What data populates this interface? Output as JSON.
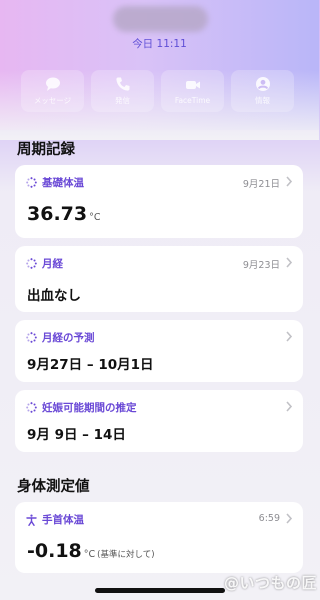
{
  "header": {
    "time": "今日 11:11",
    "actions": [
      {
        "label": "メッセージ",
        "icon": "message-icon"
      },
      {
        "label": "発信",
        "icon": "phone-icon"
      },
      {
        "label": "FaceTime",
        "icon": "video-icon"
      },
      {
        "label": "情報",
        "icon": "person-icon"
      }
    ]
  },
  "cycle_section": {
    "title": "周期記録",
    "cards": [
      {
        "title": "基礎体温",
        "date": "9月21日",
        "value": "36.73",
        "unit": "°C",
        "icon": "cycle-dots-icon"
      },
      {
        "title": "月経",
        "date": "9月23日",
        "value": "出血なし",
        "icon": "cycle-dots-icon"
      },
      {
        "title": "月経の予測",
        "value": "9月27日 – 10月1日",
        "icon": "cycle-dots-icon"
      },
      {
        "title": "妊娠可能期間の推定",
        "value": "9月 9日 – 14日",
        "icon": "cycle-dots-icon"
      }
    ]
  },
  "body_section": {
    "title": "身体測定値",
    "card": {
      "title": "手首体温",
      "date": "6:59",
      "value": "-0.18",
      "unit": "°C",
      "note": "(基準に対して)",
      "icon": "person-figure-icon"
    }
  },
  "watermark": "@いつもの匠",
  "colors": {
    "accent": "#6a49d6",
    "background": "#f2f1f6"
  }
}
